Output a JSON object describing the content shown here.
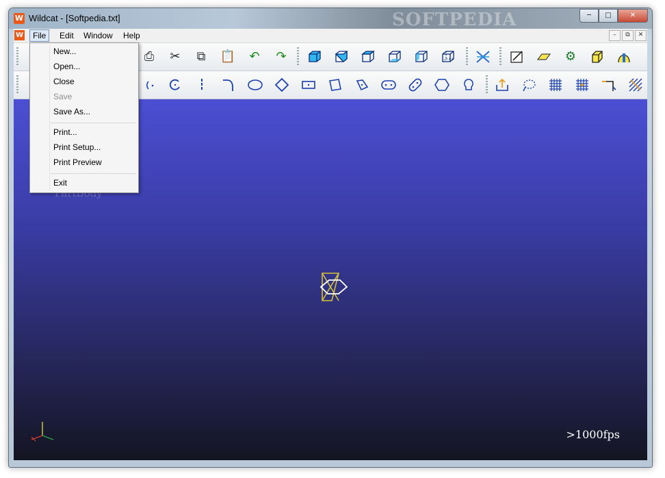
{
  "window": {
    "title": "Wildcat - [Softpedia.txt]",
    "app_icon": "W",
    "watermark": "SOFTPEDIA",
    "caption_buttons": [
      "minimize",
      "maximize",
      "close"
    ]
  },
  "menubar": {
    "doc_icon": "W",
    "items": [
      {
        "label": "File",
        "active": true
      },
      {
        "label": "Edit",
        "active": false
      },
      {
        "label": "Window",
        "active": false
      },
      {
        "label": "Help",
        "active": false
      }
    ],
    "mdi_buttons": [
      "minimize",
      "restore",
      "close"
    ]
  },
  "file_menu": {
    "items": [
      {
        "label": "New...",
        "enabled": true
      },
      {
        "label": "Open...",
        "enabled": true
      },
      {
        "label": "Close",
        "enabled": true
      },
      {
        "label": "Save",
        "enabled": false
      },
      {
        "label": "Save As...",
        "enabled": true
      },
      {
        "label": "Print...",
        "enabled": true
      },
      {
        "label": "Print Setup...",
        "enabled": true
      },
      {
        "label": "Print Preview",
        "enabled": true
      },
      {
        "label": "Exit",
        "enabled": true
      }
    ]
  },
  "toolbar1": {
    "icons": [
      "print-icon",
      "cut-icon",
      "copy-icon",
      "paste-icon",
      "undo-icon",
      "redo-icon",
      "view-front-icon",
      "view-back-icon",
      "view-top-icon",
      "view-bottom-icon",
      "view-left-icon",
      "view-right-icon",
      "intersect-icon",
      "sketch-icon",
      "plane-icon",
      "gear-icon",
      "extrude-icon",
      "revolve-icon"
    ]
  },
  "toolbar2": {
    "icons": [
      "point-icon",
      "arc-icon",
      "vertical-line-icon",
      "fillet-curve-icon",
      "ellipse-icon",
      "diamond-icon",
      "rectangle-icon",
      "parallelogram-icon",
      "skew-shape-icon",
      "slot-icon",
      "rotated-slot-icon",
      "hexagon-icon",
      "bulb-icon",
      "export-icon",
      "lasso-icon",
      "grid-icon",
      "snap-grid-icon",
      "trim-icon",
      "hatch-icon"
    ]
  },
  "viewport": {
    "tree_label": "PartBody",
    "fps_label": ">1000fps",
    "background_top": "#4b4fd2",
    "background_bottom": "#141522"
  }
}
